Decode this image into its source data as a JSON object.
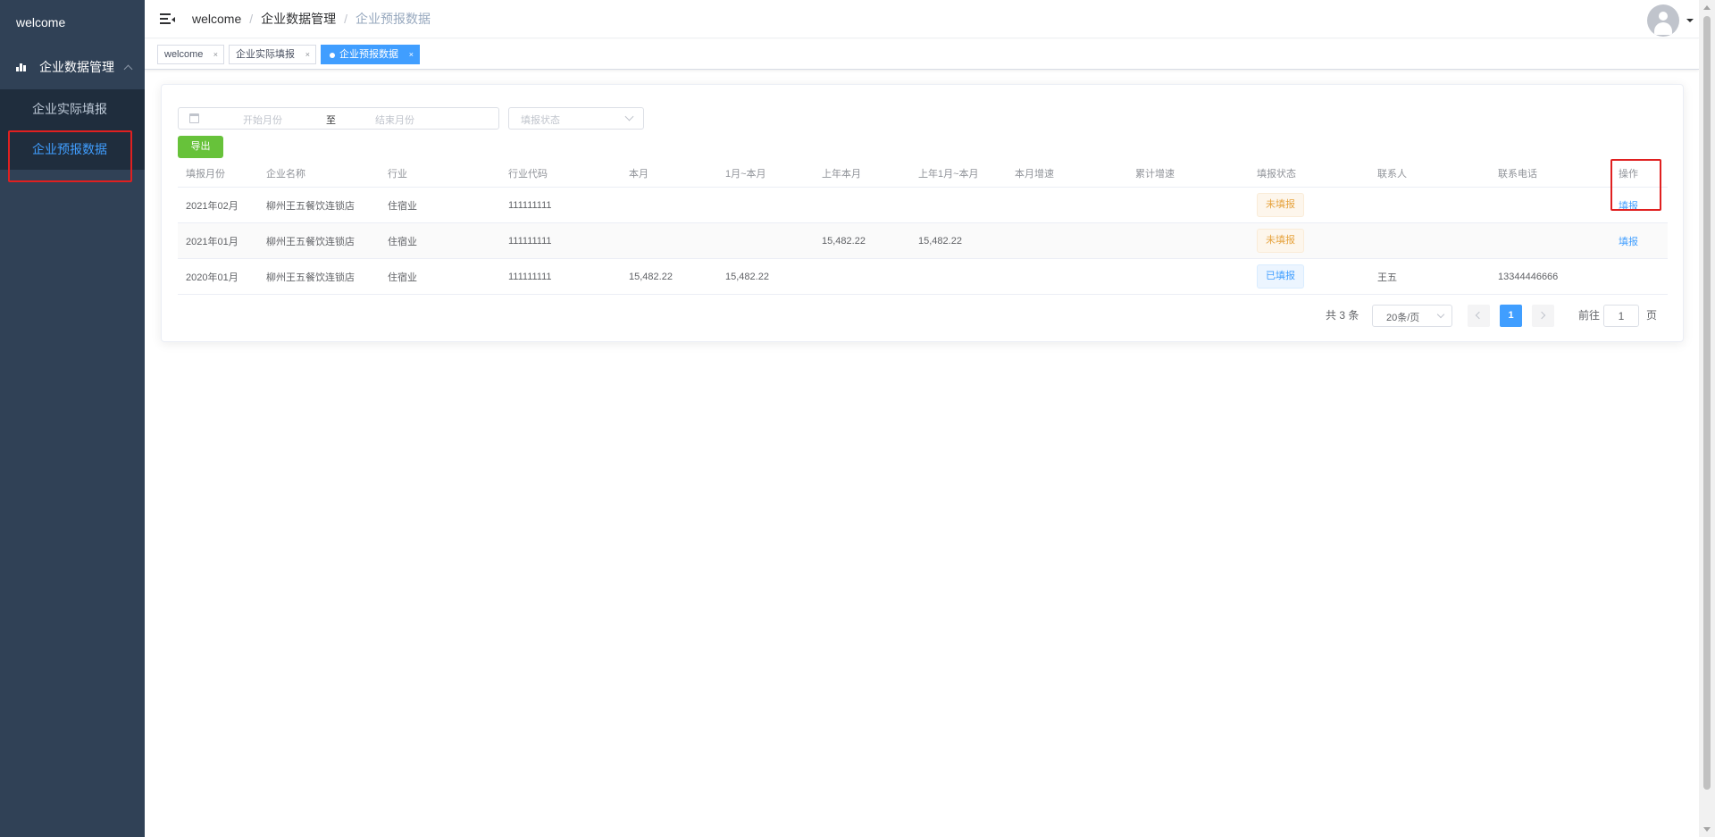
{
  "sidebar": {
    "logo": "welcome",
    "group_label": "企业数据管理",
    "items": [
      {
        "label": "企业实际填报"
      },
      {
        "label": "企业预报数据"
      }
    ]
  },
  "navbar": {
    "breadcrumb": [
      "welcome",
      "企业数据管理",
      "企业预报数据"
    ]
  },
  "tags": [
    {
      "label": "welcome"
    },
    {
      "label": "企业实际填报"
    },
    {
      "label": "企业预报数据"
    }
  ],
  "filters": {
    "start_placeholder": "开始月份",
    "range_separator": "至",
    "end_placeholder": "结束月份",
    "status_placeholder": "填报状态",
    "export_label": "导出"
  },
  "table": {
    "headers": [
      "填报月份",
      "企业名称",
      "行业",
      "行业代码",
      "本月",
      "1月~本月",
      "上年本月",
      "上年1月~本月",
      "本月增速",
      "累计增速",
      "填报状态",
      "联系人",
      "联系电话",
      "操作"
    ],
    "rows": [
      {
        "month": "2021年02月",
        "company": "柳州王五餐饮连锁店",
        "industry": "住宿业",
        "code": "111111111",
        "current": "",
        "ytd": "",
        "last_current": "",
        "last_ytd": "",
        "growth": "",
        "cum_growth": "",
        "status": "未填报",
        "contact": "",
        "phone": "",
        "action": "填报"
      },
      {
        "month": "2021年01月",
        "company": "柳州王五餐饮连锁店",
        "industry": "住宿业",
        "code": "111111111",
        "current": "",
        "ytd": "",
        "last_current": "15,482.22",
        "last_ytd": "15,482.22",
        "growth": "",
        "cum_growth": "",
        "status": "未填报",
        "contact": "",
        "phone": "",
        "action": "填报"
      },
      {
        "month": "2020年01月",
        "company": "柳州王五餐饮连锁店",
        "industry": "住宿业",
        "code": "111111111",
        "current": "15,482.22",
        "ytd": "15,482.22",
        "last_current": "",
        "last_ytd": "",
        "growth": "",
        "cum_growth": "",
        "status": "已填报",
        "contact": "王五",
        "phone": "13344446666",
        "action": ""
      }
    ]
  },
  "pagination": {
    "total": "共 3 条",
    "page_size": "20条/页",
    "current_page": "1",
    "goto_label": "前往",
    "goto_value": "1",
    "page_suffix": "页"
  },
  "colors": {
    "sidebar_bg": "#304156",
    "accent": "#409eff",
    "success": "#67c23a",
    "warning": "#e6a23c",
    "highlight_box": "#e02020"
  }
}
